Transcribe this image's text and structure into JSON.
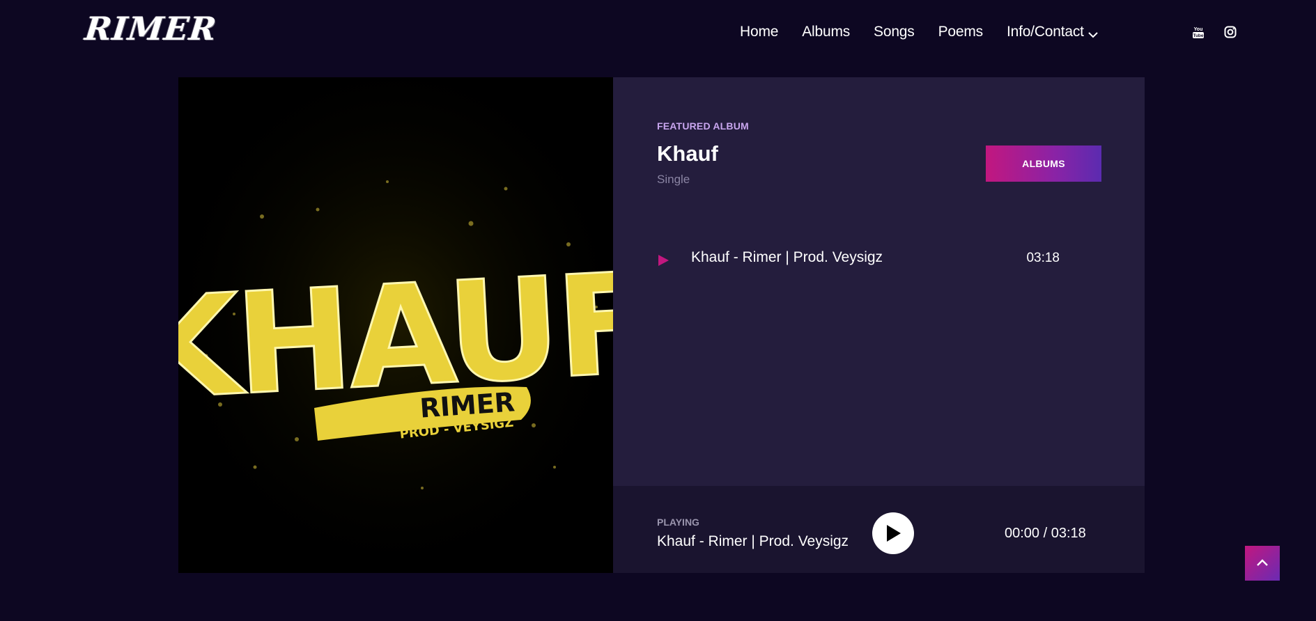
{
  "header": {
    "logo_text": "RIMER",
    "nav": [
      {
        "label": "Home"
      },
      {
        "label": "Albums"
      },
      {
        "label": "Songs"
      },
      {
        "label": "Poems"
      },
      {
        "label": "Info/Contact",
        "has_dropdown": true
      }
    ],
    "social": [
      {
        "icon": "youtube-icon"
      },
      {
        "icon": "instagram-icon"
      }
    ]
  },
  "featured": {
    "kicker": "FEATURED ALBUM",
    "title": "Khauf",
    "type": "Single",
    "albums_button": "ALBUMS",
    "cover": {
      "word": "KHAUF",
      "artist": "RIMER",
      "credit": "PROD - VEYSIGZ",
      "accent": "#e9d13a"
    },
    "tracks": [
      {
        "title": "Khauf - Rimer | Prod. Veysigz",
        "duration": "03:18"
      }
    ]
  },
  "player": {
    "label": "PLAYING",
    "now_playing": "Khauf - Rimer | Prod. Veysigz",
    "time": "00:00 / 03:18"
  },
  "colors": {
    "background": "#0d0722",
    "card": "#241d3d",
    "player": "#1a142f",
    "accent_pink": "#c2177f",
    "accent_purple": "#5b2bb0",
    "kicker": "#c9a6ef"
  },
  "scroll_top_icon": "chevron-up-icon"
}
